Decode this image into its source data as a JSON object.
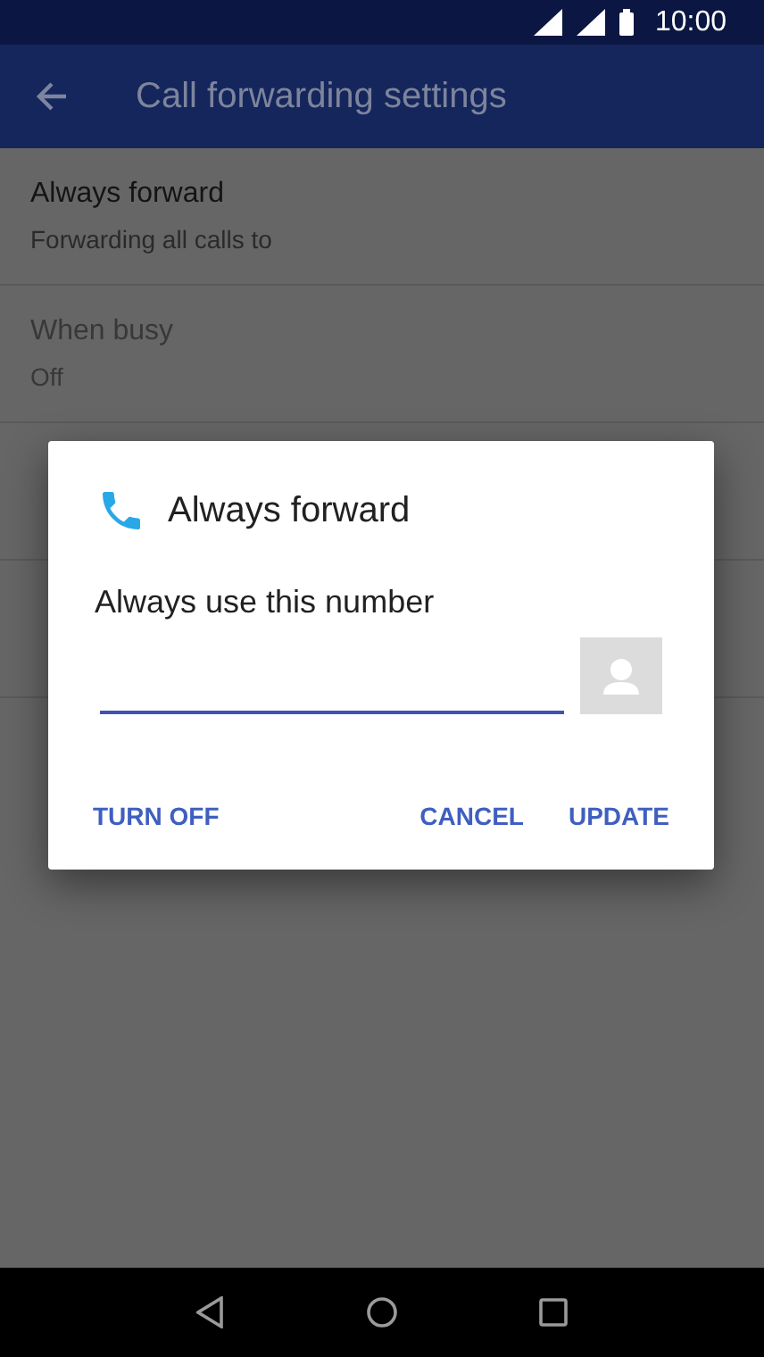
{
  "status_bar": {
    "time": "10:00"
  },
  "app_bar": {
    "title": "Call forwarding settings"
  },
  "settings": [
    {
      "title": "Always forward",
      "summary": "Forwarding all calls to",
      "disabled": false
    },
    {
      "title": "When busy",
      "summary": "Off",
      "disabled": true
    }
  ],
  "dialog": {
    "title": "Always forward",
    "label": "Always use this number",
    "field": {
      "focused": true
    },
    "buttons": [
      {
        "label": "TURN OFF"
      },
      {
        "label": "CANCEL"
      },
      {
        "label": "UPDATE"
      }
    ]
  }
}
